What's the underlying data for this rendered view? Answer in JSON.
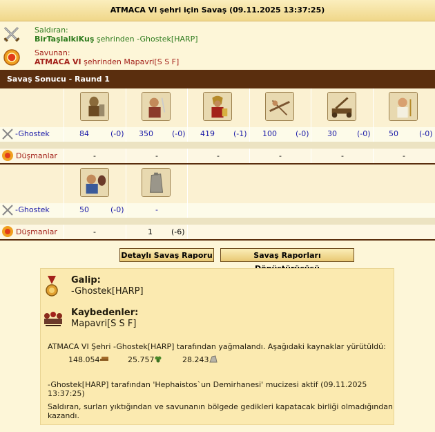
{
  "title": "ATMACA VI şehri için Savaş (09.11.2025 13:37:25)",
  "attacker": {
    "label": "Saldıran:",
    "city": "BirTaşlalkiKuş",
    "rest": " şehrinden -Ghostek[HARP]"
  },
  "defender": {
    "label": "Savunan:",
    "city": "ATMACA VI",
    "rest": " şehrinden Mapavri[S S F]"
  },
  "section_title": "Savaş Sonucu - Raund 1",
  "round1": {
    "attacker_name": "-Ghostek",
    "defender_name": "Düşmanlar",
    "units": [
      {
        "icon": "hoplite-unit-icon",
        "count": "84",
        "loss": "(-0)",
        "enemy": "-"
      },
      {
        "icon": "swordsman-unit-icon",
        "count": "350",
        "loss": "(-0)",
        "enemy": "-"
      },
      {
        "icon": "spearman-unit-icon",
        "count": "419",
        "loss": "(-1)",
        "enemy": "-"
      },
      {
        "icon": "ballista-unit-icon",
        "count": "100",
        "loss": "(-0)",
        "enemy": "-"
      },
      {
        "icon": "catapult-unit-icon",
        "count": "30",
        "loss": "(-0)",
        "enemy": "-"
      },
      {
        "icon": "doctor-unit-icon",
        "count": "50",
        "loss": "(-0)",
        "enemy": "-"
      }
    ]
  },
  "round2": {
    "attacker_name": "-Ghostek",
    "defender_name": "Düşmanlar",
    "units": [
      {
        "icon": "cook-unit-icon",
        "count": "50",
        "loss": "(-0)",
        "enemy": "-",
        "enemy_loss": ""
      },
      {
        "icon": "wall-unit-icon",
        "count": "-",
        "loss": "",
        "enemy": "1",
        "enemy_loss": "(-6)"
      }
    ]
  },
  "buttons": {
    "detail": "Detaylı Savaş Raporu",
    "converter": "Savaş Raporları Dönüştürücüsü"
  },
  "summary": {
    "winner_label": "Galip:",
    "winner": "-Ghostek[HARP]",
    "losers_label": "Kaybedenler:",
    "losers": "Mapavri[S S F]",
    "loot_text": "ATMACA VI Şehri -Ghostek[HARP] tarafından yağmalandı. Aşağıdaki kaynaklar yürütüldü:",
    "resources": [
      {
        "value": "148.054",
        "icon": "wood-icon"
      },
      {
        "value": "25.757",
        "icon": "wine-icon"
      },
      {
        "value": "28.243",
        "icon": "marble-icon"
      }
    ],
    "miracle_text": "-Ghostek[HARP] tarafından 'Hephaistos`un Demirhanesi' mucizesi aktif (09.11.2025 13:37:25)",
    "wall_text_1": "Saldıran, surları yıktığından ve savunanın bölgede gedikleri kapatacak birliği olmadığından",
    "wall_text_2": "kazandı."
  }
}
